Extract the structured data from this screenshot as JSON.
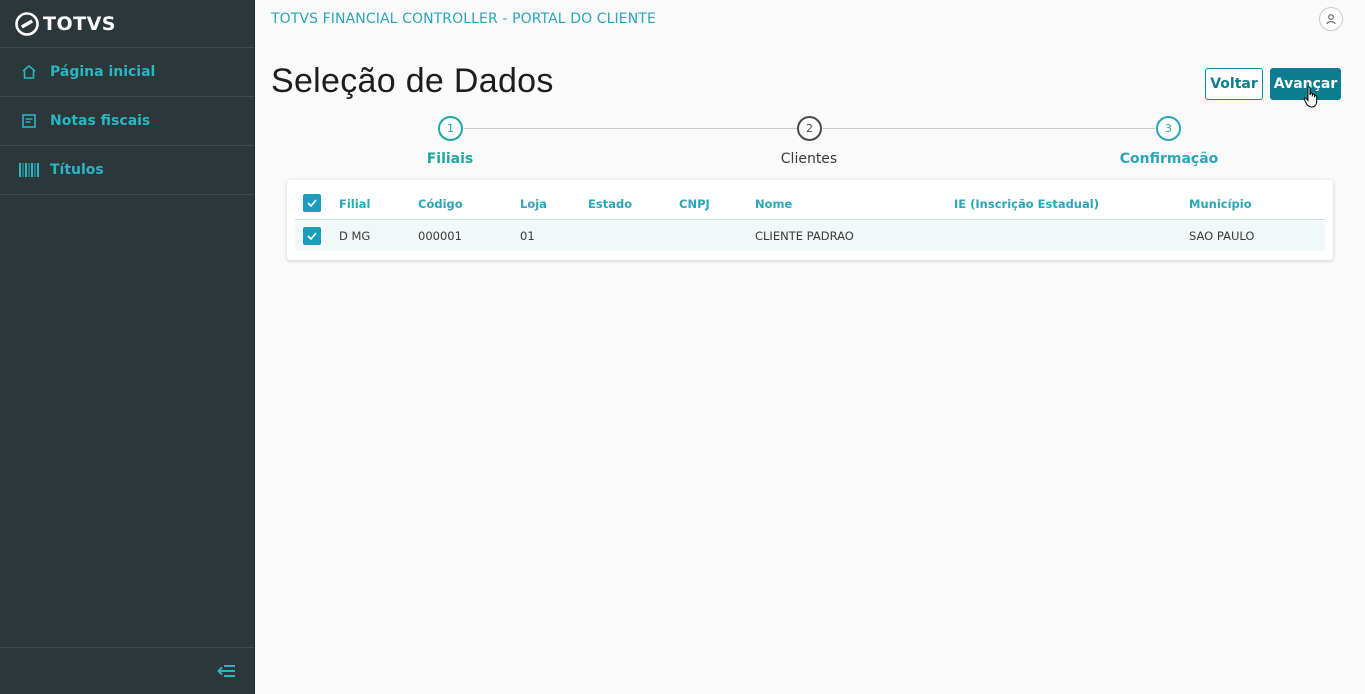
{
  "brand": {
    "name": "TOTVS"
  },
  "sidebar": {
    "items": [
      {
        "label": "Página inicial",
        "icon": "home-icon"
      },
      {
        "label": "Notas fiscais",
        "icon": "document-icon"
      },
      {
        "label": "Títulos",
        "icon": "barcode-icon"
      }
    ]
  },
  "header": {
    "title": "TOTVS FINANCIAL CONTROLLER - PORTAL DO CLIENTE"
  },
  "page": {
    "title": "Seleção de Dados"
  },
  "actions": {
    "back_label": "Voltar",
    "next_label": "Avançar"
  },
  "stepper": {
    "steps": [
      {
        "number": "1",
        "label": "Filiais",
        "state": "active"
      },
      {
        "number": "2",
        "label": "Clientes",
        "state": "default"
      },
      {
        "number": "3",
        "label": "Confirmação",
        "state": "pending"
      }
    ]
  },
  "table": {
    "columns": [
      "Filial",
      "Código",
      "Loja",
      "Estado",
      "CNPJ",
      "Nome",
      "IE (Inscrição Estadual)",
      "Município"
    ],
    "rows": [
      {
        "checked": true,
        "cells": [
          "D MG",
          "000001",
          "01",
          "",
          "",
          "CLIENTE PADRAO",
          "",
          "SAO PAULO"
        ]
      }
    ],
    "all_checked": true
  },
  "colors": {
    "sidebar_bg": "#2c3739",
    "accent": "#2aa6b8",
    "primary_button": "#0c7d90",
    "step_active": "#1ea8a1",
    "checkbox": "#1a9dbf"
  }
}
